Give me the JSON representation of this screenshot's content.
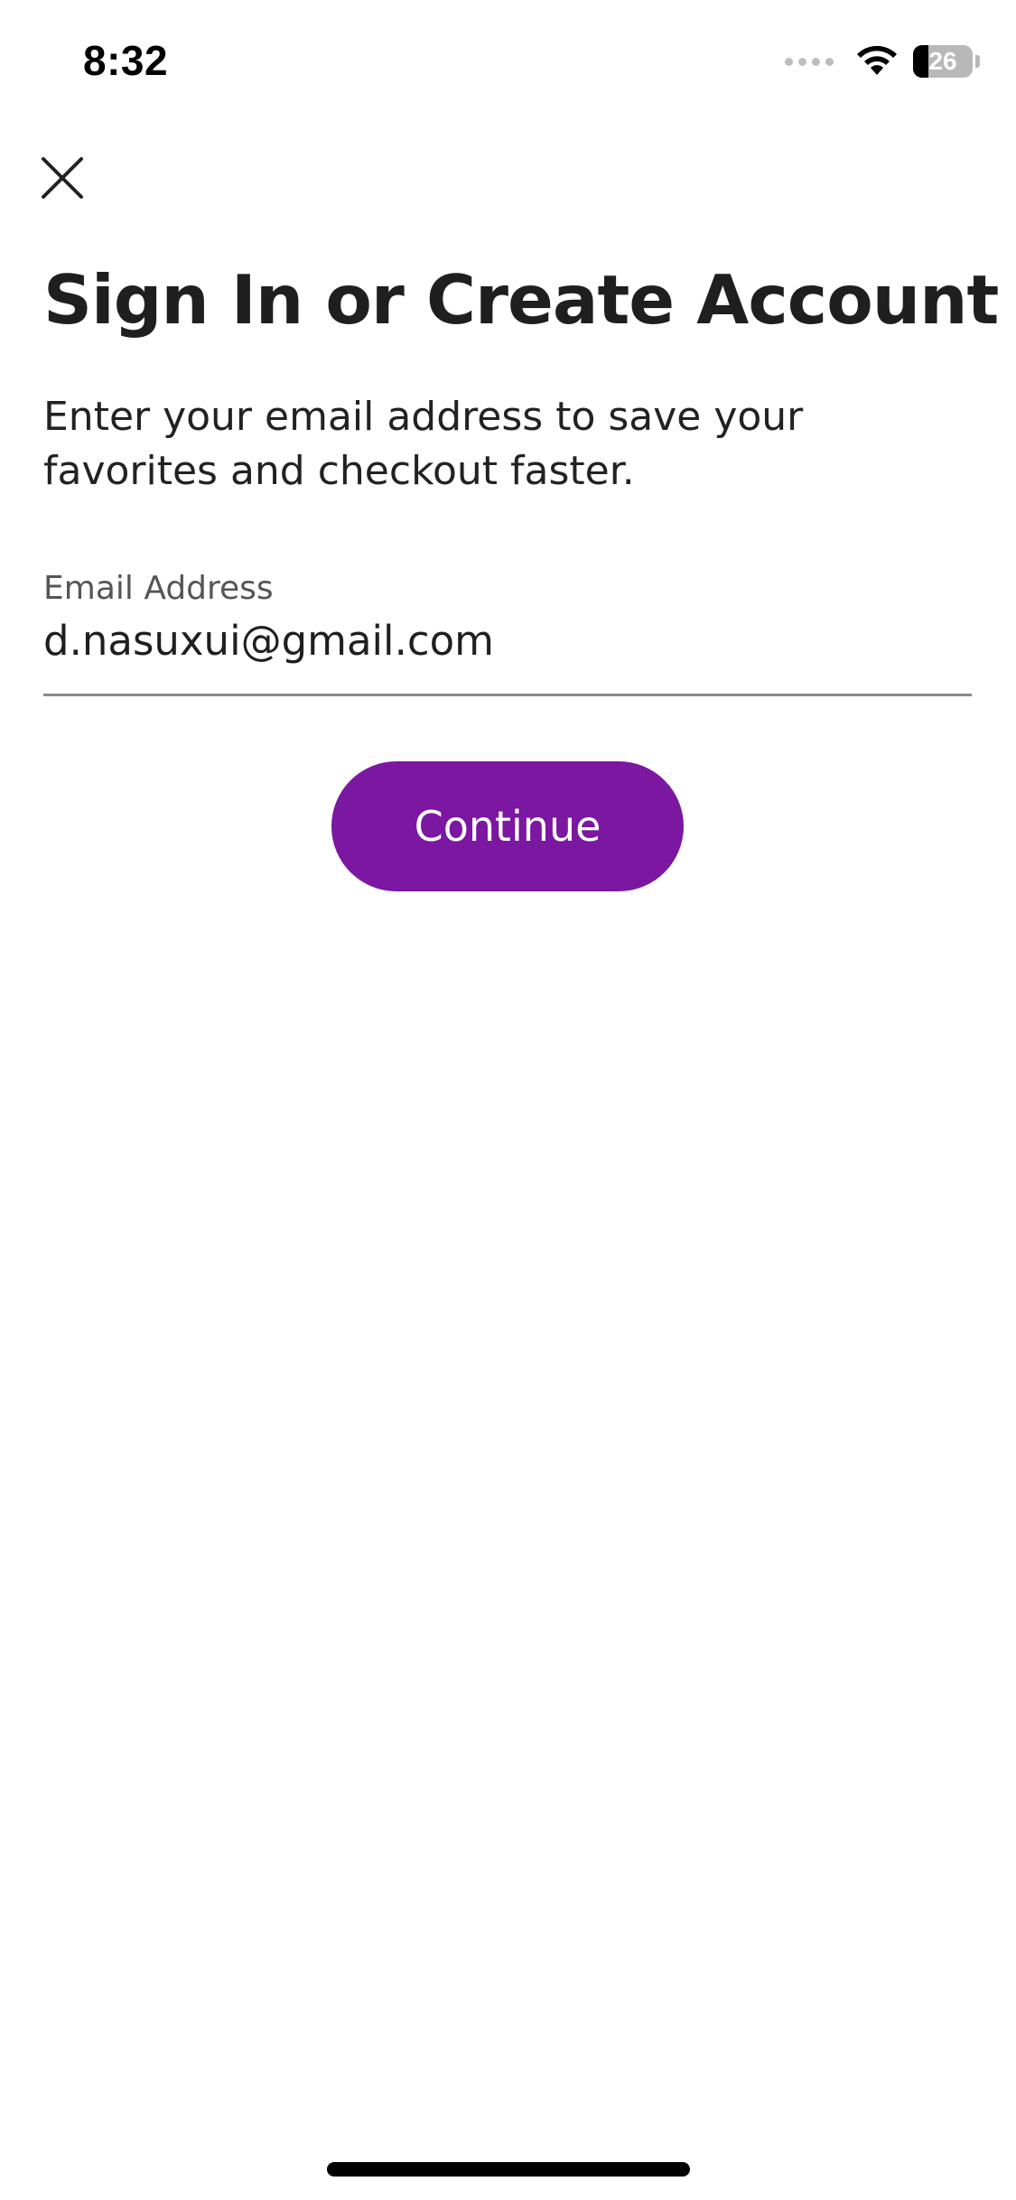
{
  "status_bar": {
    "time": "8:32",
    "battery_percent": "26",
    "battery_level": 0.26,
    "icons": [
      "cellular-signal-icon",
      "wifi-icon",
      "battery-icon"
    ]
  },
  "header": {
    "close_icon": "close-icon"
  },
  "main": {
    "title": "Sign In or Create Account",
    "subtitle": "Enter your email address to save your favorites and checkout faster.",
    "email_field": {
      "label": "Email Address",
      "value": "d.nasuxui@gmail.com"
    },
    "continue_label": "Continue"
  },
  "colors": {
    "accent": "#7b17a0",
    "text": "#1f1f1f",
    "label": "#555555",
    "underline": "#8a8a8a"
  }
}
